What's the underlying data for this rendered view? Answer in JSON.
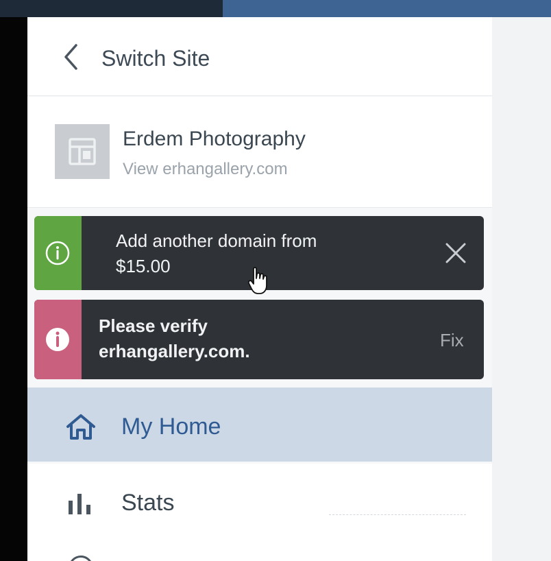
{
  "header": {
    "back_icon": "chevron-left-icon",
    "switch_site_label": "Switch Site"
  },
  "site": {
    "name": "Erdem Photography",
    "view_link": "View erhangallery.com",
    "thumbnail_icon": "layout-icon"
  },
  "notices": {
    "domain": {
      "icon": "info-circle-icon",
      "line1": "Add another domain from",
      "line2": "$15.00",
      "close_icon": "close-icon",
      "accent": "#5fa642"
    },
    "verify": {
      "icon": "info-filled-icon",
      "line1": "Please verify",
      "line2": "erhangallery.com.",
      "action": "Fix",
      "accent": "#c8607e"
    }
  },
  "nav": {
    "items": [
      {
        "label": "My Home",
        "icon": "home-icon",
        "selected": true
      },
      {
        "label": "Stats",
        "icon": "bar-chart-icon",
        "selected": false
      }
    ]
  },
  "colors": {
    "selected_bg": "#cdd8e6",
    "selected_text": "#2f5b92",
    "notice_bg": "#2f3338",
    "masterbar": "#3e6494"
  }
}
